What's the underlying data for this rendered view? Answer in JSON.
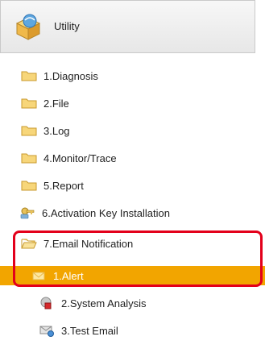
{
  "header": {
    "title": "Utility",
    "icon": "utility-box-icon"
  },
  "tree": {
    "items": [
      {
        "label": "1.Diagnosis",
        "icon": "folder-icon"
      },
      {
        "label": "2.File",
        "icon": "folder-icon"
      },
      {
        "label": "3.Log",
        "icon": "folder-icon"
      },
      {
        "label": "4.Monitor/Trace",
        "icon": "folder-icon"
      },
      {
        "label": "5.Report",
        "icon": "folder-icon"
      },
      {
        "label": "6.Activation Key Installation",
        "icon": "key-icon"
      },
      {
        "label": "7.Email Notification",
        "icon": "folder-open-icon"
      }
    ],
    "children": [
      {
        "label": "1.Alert",
        "icon": "mail-icon",
        "selected": true
      },
      {
        "label": "2.System Analysis",
        "icon": "system-analysis-icon"
      },
      {
        "label": "3.Test Email",
        "icon": "test-email-icon"
      }
    ]
  },
  "colors": {
    "selection": "#f2a500",
    "highlight_border": "#e3001b"
  }
}
